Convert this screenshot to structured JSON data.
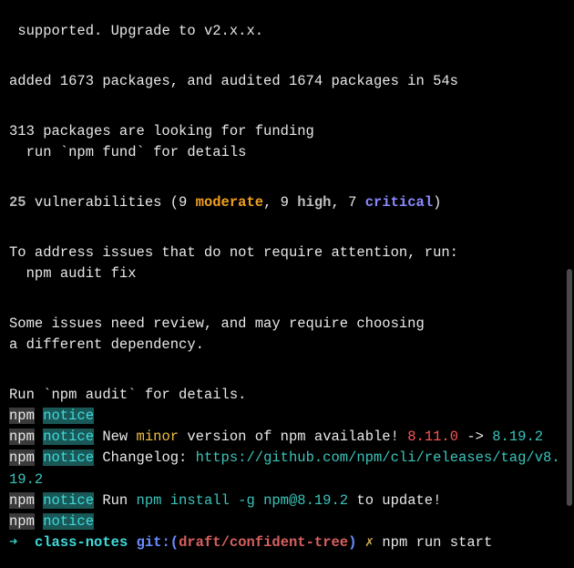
{
  "lines": {
    "l0": " supported. Upgrade to v2.x.x.",
    "blank": " ",
    "l1": "added 1673 packages, and audited 1674 packages in 54s",
    "l2": "313 packages are looking for funding",
    "l3": "  run `npm fund` for details"
  },
  "vuln": {
    "count": "25",
    "label": " vulnerabilities (9 ",
    "moderate": "moderate",
    "sep1": ", 9 ",
    "high": "high",
    "sep2": ", 7 ",
    "critical": "critical",
    "close": ")"
  },
  "post": {
    "pa": "To address issues that do not require attention, run:",
    "pb": "  npm audit fix",
    "pc": "Some issues need review, and may require choosing",
    "pd": "a different dependency.",
    "pe": "Run `npm audit` for details."
  },
  "notice": {
    "npm": "npm",
    "notice": "notice",
    "newminor_a": " New ",
    "minor": "minor",
    "newminor_b": " version of npm available! ",
    "oldver": "8.11.0",
    "arrow": " -> ",
    "newver": "8.19.2",
    "changelog_label": " Changelog: ",
    "changelog_url": "https://github.com/npm/cli/releases/tag/v8.19.2",
    "run_a": " Run ",
    "run_cmd": "npm install -g npm@8.19.2",
    "run_b": " to update!"
  },
  "prompt": {
    "arrow": "➜ ",
    "folder": " class-notes",
    "gitlabel": " git:(",
    "branch": "draft/confident-tree",
    "gitclose": ")",
    "x": " ✗",
    "cmd": " npm run start"
  }
}
